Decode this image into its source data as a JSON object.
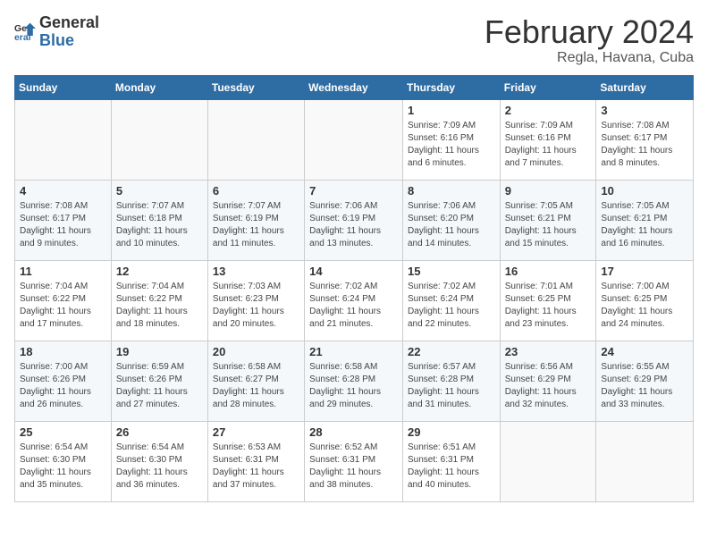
{
  "header": {
    "logo_general": "General",
    "logo_blue": "Blue",
    "title": "February 2024",
    "subtitle": "Regla, Havana, Cuba"
  },
  "calendar": {
    "weekdays": [
      "Sunday",
      "Monday",
      "Tuesday",
      "Wednesday",
      "Thursday",
      "Friday",
      "Saturday"
    ],
    "weeks": [
      {
        "days": [
          {
            "number": "",
            "info": ""
          },
          {
            "number": "",
            "info": ""
          },
          {
            "number": "",
            "info": ""
          },
          {
            "number": "",
            "info": ""
          },
          {
            "number": "1",
            "info": "Sunrise: 7:09 AM\nSunset: 6:16 PM\nDaylight: 11 hours\nand 6 minutes."
          },
          {
            "number": "2",
            "info": "Sunrise: 7:09 AM\nSunset: 6:16 PM\nDaylight: 11 hours\nand 7 minutes."
          },
          {
            "number": "3",
            "info": "Sunrise: 7:08 AM\nSunset: 6:17 PM\nDaylight: 11 hours\nand 8 minutes."
          }
        ]
      },
      {
        "days": [
          {
            "number": "4",
            "info": "Sunrise: 7:08 AM\nSunset: 6:17 PM\nDaylight: 11 hours\nand 9 minutes."
          },
          {
            "number": "5",
            "info": "Sunrise: 7:07 AM\nSunset: 6:18 PM\nDaylight: 11 hours\nand 10 minutes."
          },
          {
            "number": "6",
            "info": "Sunrise: 7:07 AM\nSunset: 6:19 PM\nDaylight: 11 hours\nand 11 minutes."
          },
          {
            "number": "7",
            "info": "Sunrise: 7:06 AM\nSunset: 6:19 PM\nDaylight: 11 hours\nand 13 minutes."
          },
          {
            "number": "8",
            "info": "Sunrise: 7:06 AM\nSunset: 6:20 PM\nDaylight: 11 hours\nand 14 minutes."
          },
          {
            "number": "9",
            "info": "Sunrise: 7:05 AM\nSunset: 6:21 PM\nDaylight: 11 hours\nand 15 minutes."
          },
          {
            "number": "10",
            "info": "Sunrise: 7:05 AM\nSunset: 6:21 PM\nDaylight: 11 hours\nand 16 minutes."
          }
        ]
      },
      {
        "days": [
          {
            "number": "11",
            "info": "Sunrise: 7:04 AM\nSunset: 6:22 PM\nDaylight: 11 hours\nand 17 minutes."
          },
          {
            "number": "12",
            "info": "Sunrise: 7:04 AM\nSunset: 6:22 PM\nDaylight: 11 hours\nand 18 minutes."
          },
          {
            "number": "13",
            "info": "Sunrise: 7:03 AM\nSunset: 6:23 PM\nDaylight: 11 hours\nand 20 minutes."
          },
          {
            "number": "14",
            "info": "Sunrise: 7:02 AM\nSunset: 6:24 PM\nDaylight: 11 hours\nand 21 minutes."
          },
          {
            "number": "15",
            "info": "Sunrise: 7:02 AM\nSunset: 6:24 PM\nDaylight: 11 hours\nand 22 minutes."
          },
          {
            "number": "16",
            "info": "Sunrise: 7:01 AM\nSunset: 6:25 PM\nDaylight: 11 hours\nand 23 minutes."
          },
          {
            "number": "17",
            "info": "Sunrise: 7:00 AM\nSunset: 6:25 PM\nDaylight: 11 hours\nand 24 minutes."
          }
        ]
      },
      {
        "days": [
          {
            "number": "18",
            "info": "Sunrise: 7:00 AM\nSunset: 6:26 PM\nDaylight: 11 hours\nand 26 minutes."
          },
          {
            "number": "19",
            "info": "Sunrise: 6:59 AM\nSunset: 6:26 PM\nDaylight: 11 hours\nand 27 minutes."
          },
          {
            "number": "20",
            "info": "Sunrise: 6:58 AM\nSunset: 6:27 PM\nDaylight: 11 hours\nand 28 minutes."
          },
          {
            "number": "21",
            "info": "Sunrise: 6:58 AM\nSunset: 6:28 PM\nDaylight: 11 hours\nand 29 minutes."
          },
          {
            "number": "22",
            "info": "Sunrise: 6:57 AM\nSunset: 6:28 PM\nDaylight: 11 hours\nand 31 minutes."
          },
          {
            "number": "23",
            "info": "Sunrise: 6:56 AM\nSunset: 6:29 PM\nDaylight: 11 hours\nand 32 minutes."
          },
          {
            "number": "24",
            "info": "Sunrise: 6:55 AM\nSunset: 6:29 PM\nDaylight: 11 hours\nand 33 minutes."
          }
        ]
      },
      {
        "days": [
          {
            "number": "25",
            "info": "Sunrise: 6:54 AM\nSunset: 6:30 PM\nDaylight: 11 hours\nand 35 minutes."
          },
          {
            "number": "26",
            "info": "Sunrise: 6:54 AM\nSunset: 6:30 PM\nDaylight: 11 hours\nand 36 minutes."
          },
          {
            "number": "27",
            "info": "Sunrise: 6:53 AM\nSunset: 6:31 PM\nDaylight: 11 hours\nand 37 minutes."
          },
          {
            "number": "28",
            "info": "Sunrise: 6:52 AM\nSunset: 6:31 PM\nDaylight: 11 hours\nand 38 minutes."
          },
          {
            "number": "29",
            "info": "Sunrise: 6:51 AM\nSunset: 6:31 PM\nDaylight: 11 hours\nand 40 minutes."
          },
          {
            "number": "",
            "info": ""
          },
          {
            "number": "",
            "info": ""
          }
        ]
      }
    ]
  }
}
